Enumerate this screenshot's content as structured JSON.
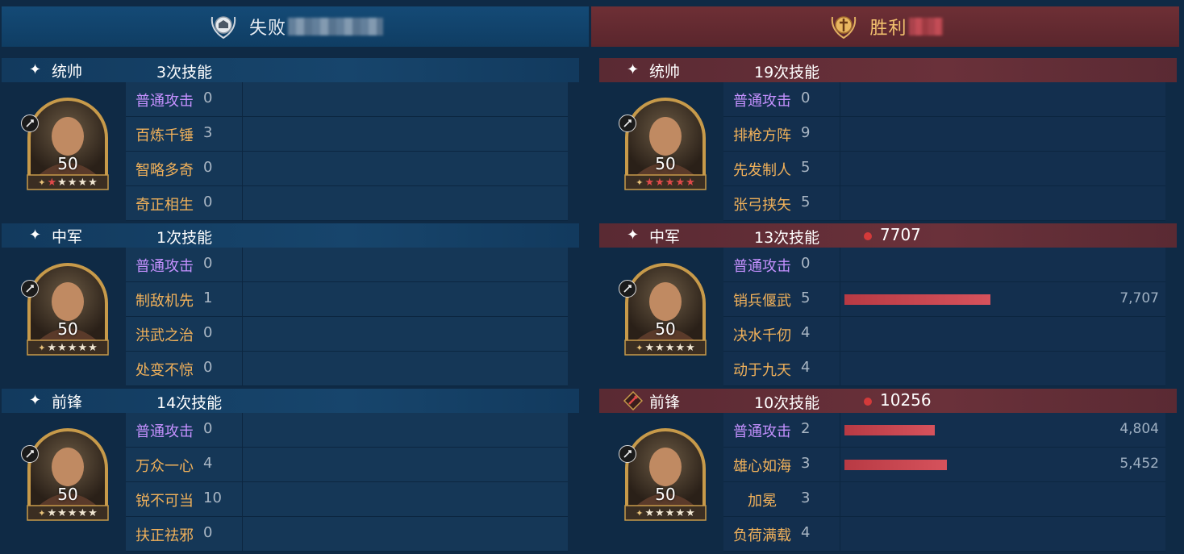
{
  "left": {
    "header_label": "失败",
    "sections": [
      {
        "role": "统帅",
        "skills": "3次技能",
        "level": "50",
        "stars": [
          1,
          0,
          0,
          0,
          0
        ],
        "rows": [
          {
            "name": "普通攻击",
            "count": "0"
          },
          {
            "name": "百炼千锤",
            "count": "3"
          },
          {
            "name": "智略多奇",
            "count": "0"
          },
          {
            "name": "奇正相生",
            "count": "0"
          }
        ]
      },
      {
        "role": "中军",
        "skills": "1次技能",
        "level": "50",
        "stars": [
          0,
          0,
          0,
          0,
          0
        ],
        "rows": [
          {
            "name": "普通攻击",
            "count": "0"
          },
          {
            "name": "制敌机先",
            "count": "1"
          },
          {
            "name": "洪武之治",
            "count": "0"
          },
          {
            "name": "处变不惊",
            "count": "0"
          }
        ]
      },
      {
        "role": "前锋",
        "skills": "14次技能",
        "level": "50",
        "stars": [
          0,
          0,
          0,
          0,
          0
        ],
        "rows": [
          {
            "name": "普通攻击",
            "count": "0"
          },
          {
            "name": "万众一心",
            "count": "4"
          },
          {
            "name": "锐不可当",
            "count": "10"
          },
          {
            "name": "扶正祛邪",
            "count": "0"
          }
        ]
      }
    ]
  },
  "right": {
    "header_label": "胜利",
    "sections": [
      {
        "role": "统帅",
        "skills": "19次技能",
        "level": "50",
        "stars": [
          1,
          1,
          1,
          1,
          1
        ],
        "rows": [
          {
            "name": "普通攻击",
            "count": "0"
          },
          {
            "name": "排枪方阵",
            "count": "9"
          },
          {
            "name": "先发制人",
            "count": "5"
          },
          {
            "name": "张弓挟矢",
            "count": "5"
          }
        ]
      },
      {
        "role": "中军",
        "skills": "13次技能",
        "damage": "7707",
        "level": "50",
        "stars": [
          0,
          0,
          0,
          0,
          0
        ],
        "rows": [
          {
            "name": "普通攻击",
            "count": "0"
          },
          {
            "name": "销兵偃武",
            "count": "5",
            "value": "7,707",
            "fraction": 0.47
          },
          {
            "name": "决水千仞",
            "count": "4"
          },
          {
            "name": "动于九天",
            "count": "4"
          }
        ]
      },
      {
        "role": "前锋",
        "skills": "10次技能",
        "damage": "10256",
        "level": "50",
        "stars": [
          0,
          0,
          0,
          0,
          0
        ],
        "rows": [
          {
            "name": "普通攻击",
            "count": "2",
            "value": "4,804",
            "fraction": 0.29
          },
          {
            "name": "雄心如海",
            "count": "3",
            "value": "5,452",
            "fraction": 0.33
          },
          {
            "name": "加冕",
            "count": "3"
          },
          {
            "name": "负荷满载",
            "count": "4"
          }
        ]
      }
    ]
  },
  "colors": {
    "skill_name": "#f1b15a",
    "basic_attack": "#c591ff",
    "damage_bar": "#c8434d",
    "gold_frame": "#c79a4a"
  }
}
